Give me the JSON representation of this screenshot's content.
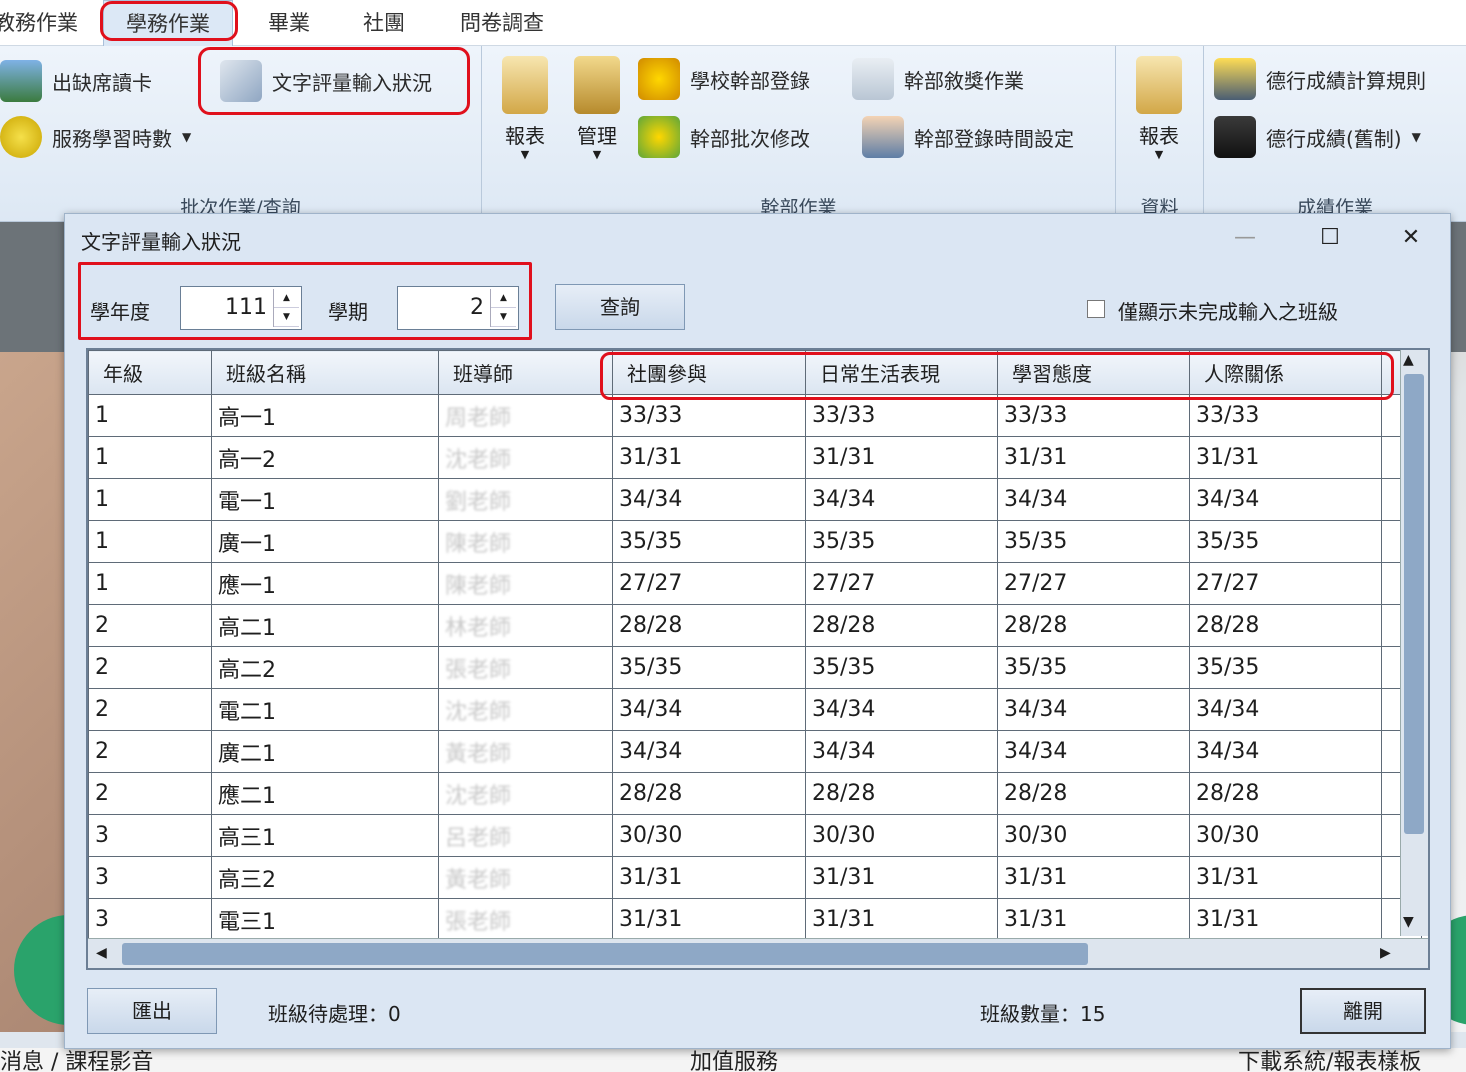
{
  "ribbon": {
    "tabs": [
      "教務作業",
      "學務作業",
      "畢業",
      "社團",
      "問卷調查"
    ],
    "groups": {
      "batch": {
        "label": "批次作業/查詢",
        "items": [
          "出缺席讀卡",
          "服務學習時數",
          "文字評量輸入狀況"
        ]
      },
      "cadre": {
        "label": "幹部作業",
        "big": [
          "報表",
          "管理"
        ],
        "items": [
          "學校幹部登錄",
          "幹部敘獎作業",
          "幹部批次修改",
          "幹部登錄時間設定"
        ]
      },
      "data": {
        "label": "資料",
        "big": [
          "報表"
        ]
      },
      "grade": {
        "label": "成績作業",
        "items": [
          "德行成績計算規則",
          "德行成績(舊制)"
        ]
      }
    }
  },
  "background": {
    "bottom_texts": [
      "消息 / 課程影音",
      "加值服務",
      "下載系統/報表樣板"
    ]
  },
  "dialog": {
    "title": "文字評量輸入狀況",
    "school_year_label": "學年度",
    "school_year": "111",
    "semester_label": "學期",
    "semester": "2",
    "query_button": "查詢",
    "only_incomplete_label": "僅顯示未完成輸入之班級",
    "export_button": "匯出",
    "pending_label": "班級待處理：0",
    "count_label": "班級數量：15",
    "close_button": "離開"
  },
  "table": {
    "columns": [
      "年級",
      "班級名稱",
      "班導師",
      "社團參與",
      "日常生活表現",
      "學習態度",
      "人際關係"
    ],
    "rows": [
      [
        "1",
        "高一1",
        "周老師",
        "33/33",
        "33/33",
        "33/33",
        "33/33"
      ],
      [
        "1",
        "高一2",
        "沈老師",
        "31/31",
        "31/31",
        "31/31",
        "31/31"
      ],
      [
        "1",
        "電一1",
        "劉老師",
        "34/34",
        "34/34",
        "34/34",
        "34/34"
      ],
      [
        "1",
        "廣一1",
        "陳老師",
        "35/35",
        "35/35",
        "35/35",
        "35/35"
      ],
      [
        "1",
        "應一1",
        "陳老師",
        "27/27",
        "27/27",
        "27/27",
        "27/27"
      ],
      [
        "2",
        "高二1",
        "林老師",
        "28/28",
        "28/28",
        "28/28",
        "28/28"
      ],
      [
        "2",
        "高二2",
        "張老師",
        "35/35",
        "35/35",
        "35/35",
        "35/35"
      ],
      [
        "2",
        "電二1",
        "沈老師",
        "34/34",
        "34/34",
        "34/34",
        "34/34"
      ],
      [
        "2",
        "廣二1",
        "黃老師",
        "34/34",
        "34/34",
        "34/34",
        "34/34"
      ],
      [
        "2",
        "應二1",
        "沈老師",
        "28/28",
        "28/28",
        "28/28",
        "28/28"
      ],
      [
        "3",
        "高三1",
        "呂老師",
        "30/30",
        "30/30",
        "30/30",
        "30/30"
      ],
      [
        "3",
        "高三2",
        "黃老師",
        "31/31",
        "31/31",
        "31/31",
        "31/31"
      ],
      [
        "3",
        "電三1",
        "張老師",
        "31/31",
        "31/31",
        "31/31",
        "31/31"
      ]
    ]
  }
}
